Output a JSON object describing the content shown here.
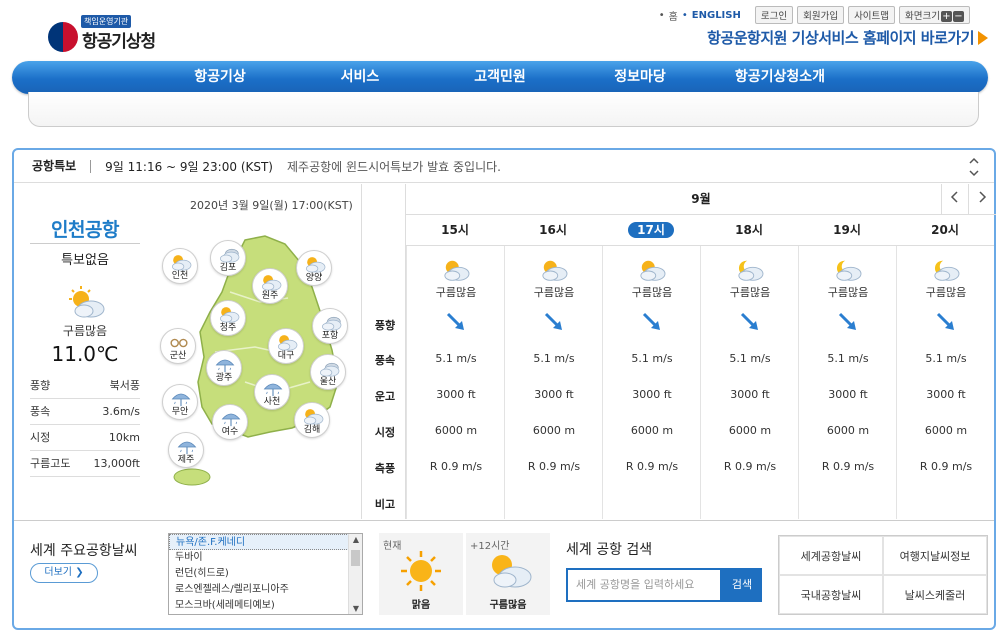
{
  "header": {
    "logo_tag": "책임운영기관",
    "logo_name": "항공기상청",
    "home": "홈",
    "english": "ENGLISH",
    "login": "로그인",
    "join": "회원가입",
    "sitemap": "사이트맵",
    "zoom_label": "화면크기",
    "zoom_in": "+",
    "zoom_out": "−",
    "shortcut": "항공운항지원 기상서비스 홈페이지 바로가기"
  },
  "nav": [
    "항공기상",
    "서비스",
    "고객민원",
    "정보마당",
    "항공기상청소개"
  ],
  "alert": {
    "title": "공항특보",
    "time": "9일 11:16 ~ 9일 23:00 (KST)",
    "message": "제주공항에 윈드시어특보가 발효 중입니다."
  },
  "current": {
    "datetime": "2020년 3월 9일(월) 17:00(KST)",
    "airport": "인천공항",
    "warning": "특보없음",
    "weather": "구름많음",
    "temperature": "11.0℃",
    "rows": [
      {
        "label": "풍향",
        "value": "북서풍"
      },
      {
        "label": "풍속",
        "value": "3.6m/s"
      },
      {
        "label": "시정",
        "value": "10km"
      },
      {
        "label": "구름고도",
        "value": "13,000ft"
      }
    ]
  },
  "map_cities": [
    {
      "name": "인천",
      "icon": "partly-cloudy-sun-icon"
    },
    {
      "name": "김포",
      "icon": "cloudy-icon"
    },
    {
      "name": "양양",
      "icon": "partly-cloudy-sun-icon"
    },
    {
      "name": "원주",
      "icon": "partly-cloudy-sun-icon"
    },
    {
      "name": "청주",
      "icon": "partly-cloudy-sun-icon"
    },
    {
      "name": "포항",
      "icon": "cloudy-icon"
    },
    {
      "name": "군산",
      "icon": "haze-icon"
    },
    {
      "name": "대구",
      "icon": "partly-cloudy-sun-icon"
    },
    {
      "name": "광주",
      "icon": "rain-icon"
    },
    {
      "name": "울산",
      "icon": "cloudy-icon"
    },
    {
      "name": "무안",
      "icon": "rain-icon"
    },
    {
      "name": "사천",
      "icon": "rain-icon"
    },
    {
      "name": "여수",
      "icon": "rain-icon"
    },
    {
      "name": "김해",
      "icon": "partly-cloudy-sun-icon"
    },
    {
      "name": "제주",
      "icon": "rain-icon"
    }
  ],
  "forecast": {
    "month": "9월",
    "row_labels": [
      "풍향",
      "풍속",
      "운고",
      "시정",
      "측풍",
      "비고"
    ],
    "hours": [
      {
        "hour": "15시",
        "weather": "구름많음",
        "icon": "partly-cloudy-sun-icon",
        "speed": "5.1 m/s",
        "ceiling": "3000 ft",
        "visibility": "6000 m",
        "crosswind": "R 0.9 m/s",
        "selected": false
      },
      {
        "hour": "16시",
        "weather": "구름많음",
        "icon": "partly-cloudy-sun-icon",
        "speed": "5.1 m/s",
        "ceiling": "3000 ft",
        "visibility": "6000 m",
        "crosswind": "R 0.9 m/s",
        "selected": false
      },
      {
        "hour": "17시",
        "weather": "구름많음",
        "icon": "partly-cloudy-sun-icon",
        "speed": "5.1 m/s",
        "ceiling": "3000 ft",
        "visibility": "6000 m",
        "crosswind": "R 0.9 m/s",
        "selected": true
      },
      {
        "hour": "18시",
        "weather": "구름많음",
        "icon": "partly-cloudy-moon-icon",
        "speed": "5.1 m/s",
        "ceiling": "3000 ft",
        "visibility": "6000 m",
        "crosswind": "R 0.9 m/s",
        "selected": false
      },
      {
        "hour": "19시",
        "weather": "구름많음",
        "icon": "partly-cloudy-moon-icon",
        "speed": "5.1 m/s",
        "ceiling": "3000 ft",
        "visibility": "6000 m",
        "crosswind": "R 0.9 m/s",
        "selected": false
      },
      {
        "hour": "20시",
        "weather": "구름많음",
        "icon": "partly-cloudy-moon-icon",
        "speed": "5.1 m/s",
        "ceiling": "3000 ft",
        "visibility": "6000 m",
        "crosswind": "R 0.9 m/s",
        "selected": false
      }
    ]
  },
  "world": {
    "title": "세계 주요공항날씨",
    "more": "더보기",
    "list": [
      "뉴욕/존.F.케네디",
      "두바이",
      "런던(히드로)",
      "로스엔젤레스/렐리포니아주",
      "모스크바(세레메티예보)"
    ],
    "now_label": "현재",
    "now_weather": "맑음",
    "later_label": "+12시간",
    "later_weather": "구름많음"
  },
  "search": {
    "title": "세계 공항 검색",
    "placeholder": "세계 공항명을 입력하세요",
    "button": "검색"
  },
  "quicklinks": [
    "세계공항날씨",
    "여행지날씨정보",
    "국내공항날씨",
    "날씨스케줄러"
  ],
  "colors": {
    "brand_blue": "#1e6fc0",
    "nav_gradient_top": "#4aa3ea",
    "map_green": "#c6de7b",
    "arrow_orange": "#f29200"
  }
}
